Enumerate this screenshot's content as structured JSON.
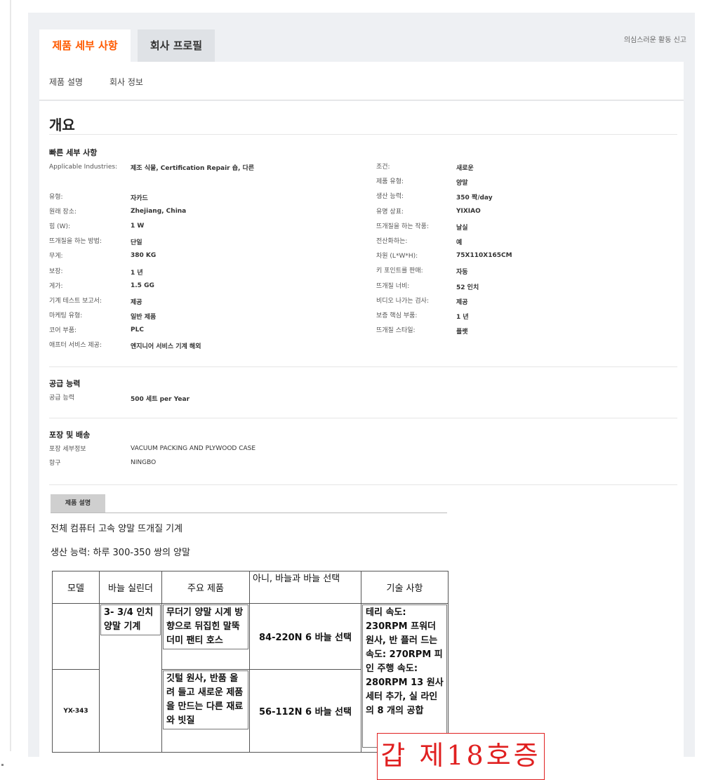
{
  "tabs": {
    "active": "제품 세부 사항",
    "inactive": "회사 프로필"
  },
  "report_link": "의심스러운 활동 신고",
  "subnav": {
    "item1": "제품 설명",
    "item2": "회사 정보"
  },
  "overview_title": "개요",
  "quick_details": {
    "title": "빠른 세부 사항",
    "left": [
      {
        "k": "Applicable Industries:",
        "v": "제조 식물, Certification Repair 숍, 다른"
      },
      {
        "k": "유형:",
        "v": "자카드"
      },
      {
        "k": "원래 장소:",
        "v": "Zhejiang, China"
      },
      {
        "k": "힘 (W):",
        "v": "1 W"
      },
      {
        "k": "뜨개질을 하는 방법:",
        "v": "단일"
      },
      {
        "k": "무게:",
        "v": "380 KG"
      },
      {
        "k": "보장:",
        "v": "1 년"
      },
      {
        "k": "게가:",
        "v": "1.5 GG"
      },
      {
        "k": "기계 테스트 보고서:",
        "v": "제공"
      },
      {
        "k": "마케팅 유형:",
        "v": "일반 제품"
      },
      {
        "k": "코어 부품:",
        "v": "PLC"
      },
      {
        "k": "애프터 서비스 제공:",
        "v": "엔지니어 서비스 기계 해외"
      }
    ],
    "right": [
      {
        "k": "조건:",
        "v": "새로운"
      },
      {
        "k": "제품 유형:",
        "v": "양말"
      },
      {
        "k": "생산 능력:",
        "v": "350 짝/day"
      },
      {
        "k": "유명 상표:",
        "v": "YIXIAO"
      },
      {
        "k": "뜨개질을 하는 작풍:",
        "v": "날실"
      },
      {
        "k": "전산화하는:",
        "v": "예"
      },
      {
        "k": "차원 (L*W*H):",
        "v": "75X110X165CM"
      },
      {
        "k": "키 포인트를 판매:",
        "v": "자동"
      },
      {
        "k": "뜨개질 너비:",
        "v": "52 인치"
      },
      {
        "k": "비디오 나가는 검사:",
        "v": "제공"
      },
      {
        "k": "보증 핵심 부품:",
        "v": "1 년"
      },
      {
        "k": "뜨개질 스타일:",
        "v": "플랫"
      }
    ]
  },
  "supply": {
    "title": "공급 능력",
    "k": "공급 능력",
    "v": "500 세트 per Year"
  },
  "packaging": {
    "title": "포장 및 배송",
    "k1": "포장 세부정보",
    "v1": "VACUUM PACKING AND PLYWOOD CASE",
    "k2": "항구",
    "v2": "NINGBO"
  },
  "description": {
    "button": "제품 설명",
    "line1": "전체 컴퓨터 고속 양말 뜨개질 기계",
    "line2": "생산 능력: 하루 300-350 쌍의 양말"
  },
  "table": {
    "headers": [
      "모델",
      "바늘 실린더",
      "주요 제품",
      "아니, 바늘과 바늘 선택",
      "기술 사항"
    ],
    "model": "YX-343",
    "cylinder": "3- 3/4 인치 양말 기계",
    "product1": "무더기 양말 시계 방향으로 뒤집힌 말뚝 더미 팬티 호스",
    "needle1": "84-220N 6 바늘 선택",
    "product2": "깃털 원사, 반품 올려 들고 새로운 제품을 만드는 다른 재료와 빗질",
    "needle2": "56-112N 6 바늘 선택",
    "tech": "테리 속도: 230RPM 프워더 원사, 반 플러 드는 속도: 270RPM 피인 주행 속도: 280RPM 13 원사 세터 추가, 실 라인의 8 개의 공합"
  },
  "stamp": "갑 제18호증"
}
